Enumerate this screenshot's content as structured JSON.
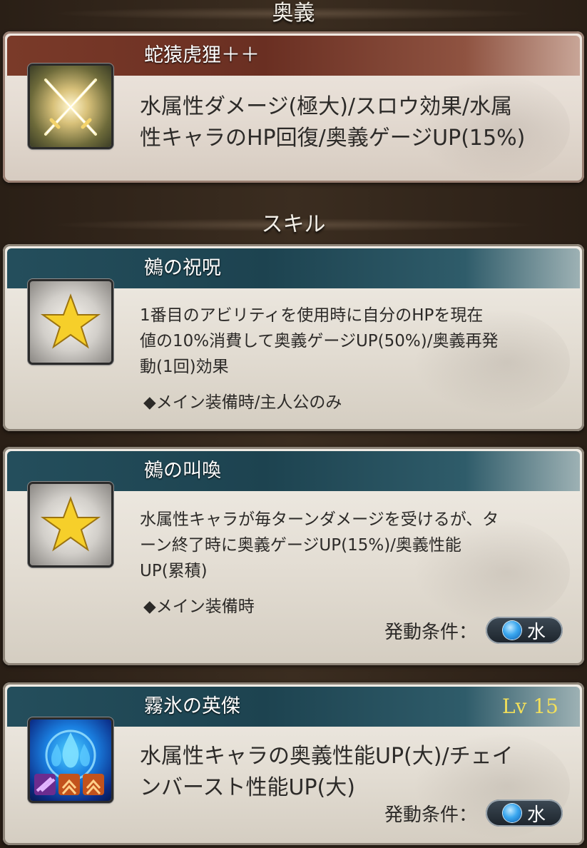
{
  "sections": {
    "ougi_header": "奥義",
    "skill_header": "スキル"
  },
  "ougi": {
    "name": "蛇猿虎狸＋＋",
    "description_line1": "水属性ダメージ(極大)/スロウ効果/水属",
    "description_line2": "性キャラのHP回復/奥義ゲージUP(15%)",
    "icon": "crossed-swords-icon"
  },
  "skills": [
    {
      "name": "鵺の祝呪",
      "icon": "star-icon",
      "description_line1": "1番目のアビリティを使用時に自分のHPを現在",
      "description_line2": "値の10%消費して奥義ゲージUP(50%)/奥義再発",
      "description_line3": "動(1回)効果",
      "note": "◆メイン装備時/主人公のみ"
    },
    {
      "name": "鵺の叫喚",
      "icon": "star-icon",
      "description_line1": "水属性キャラが毎ターンダメージを受けるが、タ",
      "description_line2": "ーン終了時に奥義ゲージUP(15%)/奥義性能",
      "description_line3": "UP(累積)",
      "note": "◆メイン装備時",
      "condition_label": "発動条件：",
      "condition_element": "水"
    },
    {
      "name": "霧氷の英傑",
      "level": "Lv 15",
      "icon": "water-flame-icon",
      "description_line1": "水属性キャラの奥義性能UP(大)/チェイ",
      "description_line2": "ンバースト性能UP(大)",
      "condition_label": "発動条件：",
      "condition_element": "水"
    }
  ],
  "colors": {
    "ougi_title_bar": "#7a3a29",
    "skill_title_bar": "#244e5c",
    "level_text": "#f2df5a",
    "water": "#3aa7ef"
  }
}
